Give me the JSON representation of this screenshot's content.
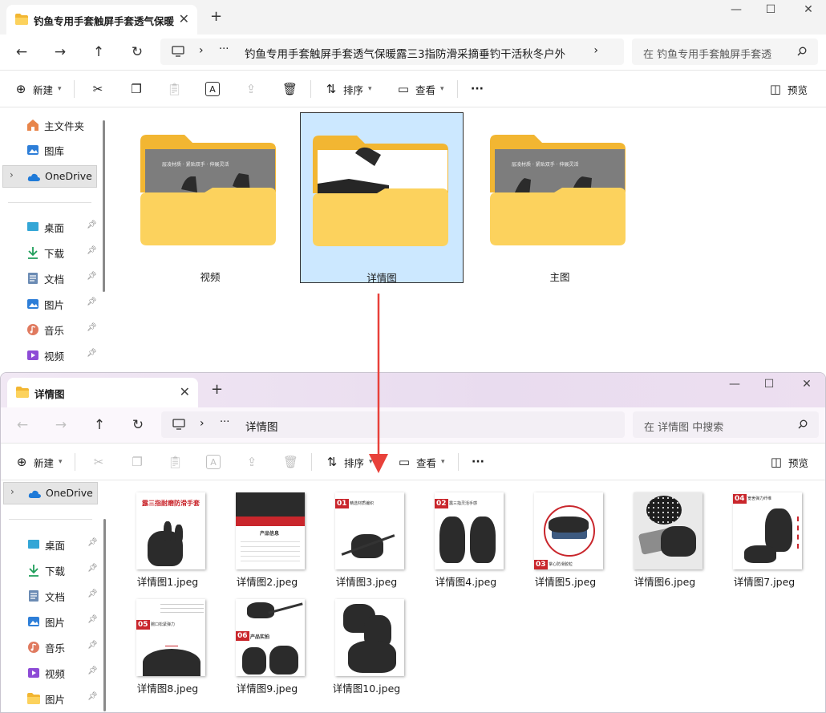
{
  "window_top": {
    "tab_title": "钓鱼专用手套触屏手套透气保暖",
    "address_path": "钓鱼专用手套触屏手套透气保暖露三3指防滑采摘垂钓干活秋冬户外",
    "search_placeholder": "在 钓鱼专用手套触屏手套透",
    "toolbar": {
      "new_label": "新建",
      "sort_label": "排序",
      "view_label": "查看",
      "more_label": "···",
      "preview_label": "预览"
    },
    "sidebar": [
      {
        "label": "主文件夹",
        "icon": "home-icon"
      },
      {
        "label": "图库",
        "icon": "gallery-icon"
      },
      {
        "label": "OneDrive",
        "icon": "cloud-icon"
      },
      {
        "label": "桌面",
        "icon": "desktop-icon"
      },
      {
        "label": "下载",
        "icon": "download-icon"
      },
      {
        "label": "文档",
        "icon": "document-icon"
      },
      {
        "label": "图片",
        "icon": "pictures-icon"
      },
      {
        "label": "音乐",
        "icon": "music-icon"
      },
      {
        "label": "视频",
        "icon": "video-icon"
      }
    ],
    "folders": [
      {
        "name": "视频",
        "banner": "层凌材质 · 紧贴双手 · 伸展灵活"
      },
      {
        "name": "详情图",
        "selected": true
      },
      {
        "name": "主图",
        "banner": "层凌材质 · 紧贴双手 · 伸展灵活"
      }
    ]
  },
  "window_bottom": {
    "tab_title": "详情图",
    "address_path": "详情图",
    "search_placeholder": "在 详情图 中搜索",
    "toolbar": {
      "new_label": "新建",
      "sort_label": "排序",
      "view_label": "查看",
      "more_label": "···",
      "preview_label": "预览"
    },
    "sidebar": [
      {
        "label": "OneDrive",
        "icon": "cloud-icon"
      },
      {
        "label": "桌面",
        "icon": "desktop-icon"
      },
      {
        "label": "下载",
        "icon": "download-icon"
      },
      {
        "label": "文档",
        "icon": "document-icon"
      },
      {
        "label": "图片",
        "icon": "pictures-icon"
      },
      {
        "label": "音乐",
        "icon": "music-icon"
      },
      {
        "label": "视频",
        "icon": "video-icon"
      },
      {
        "label": "图片",
        "icon": "folder-icon"
      }
    ],
    "files": [
      {
        "name": "详情图1.jpeg",
        "num": "",
        "caption": "露三指耐磨防滑手套"
      },
      {
        "name": "详情图2.jpeg",
        "num": "",
        "caption": "产品信息"
      },
      {
        "name": "详情图3.jpeg",
        "num": "01",
        "caption": "精选材质编织"
      },
      {
        "name": "详情图4.jpeg",
        "num": "02",
        "caption": "露三指灵活手感"
      },
      {
        "name": "详情图5.jpeg",
        "num": "03",
        "caption": "掌心防滑胶粒"
      },
      {
        "name": "详情图6.jpeg",
        "num": "",
        "caption": ""
      },
      {
        "name": "详情图7.jpeg",
        "num": "04",
        "caption": "宽舍弹力纤维"
      },
      {
        "name": "详情图8.jpeg",
        "num": "05",
        "caption": "腕口松紧弹力"
      },
      {
        "name": "详情图9.jpeg",
        "num": "06",
        "caption": "产品实拍"
      },
      {
        "name": "详情图10.jpeg",
        "num": "",
        "caption": ""
      }
    ]
  },
  "colors": {
    "accent_arrow": "#e8413a",
    "folder_yellow": "#f7c744",
    "selection": "#cce8ff",
    "brand_red": "#c9262c"
  }
}
